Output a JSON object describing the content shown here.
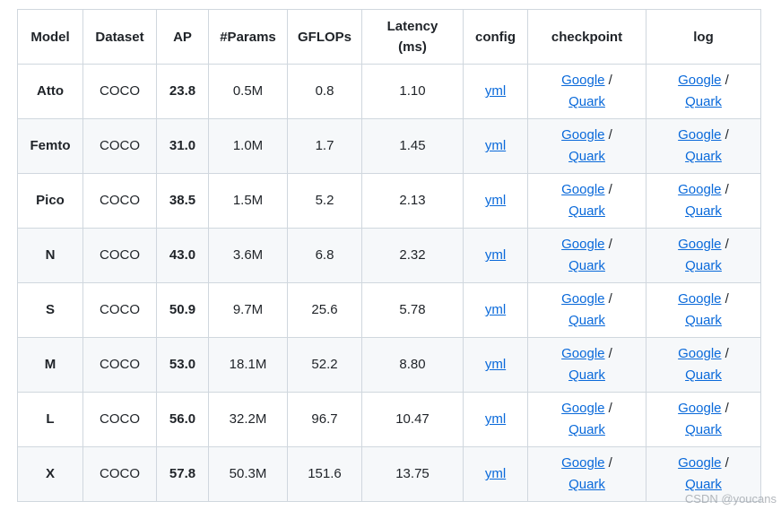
{
  "headers": [
    "Model",
    "Dataset",
    "AP",
    "#Params",
    "GFLOPs",
    "Latency",
    "config",
    "checkpoint",
    "log"
  ],
  "latency_unit": "(ms)",
  "rows": [
    {
      "model": "Atto",
      "dataset": "COCO",
      "ap": "23.8",
      "params": "0.5M",
      "gflops": "0.8",
      "latency": "1.10"
    },
    {
      "model": "Femto",
      "dataset": "COCO",
      "ap": "31.0",
      "params": "1.0M",
      "gflops": "1.7",
      "latency": "1.45"
    },
    {
      "model": "Pico",
      "dataset": "COCO",
      "ap": "38.5",
      "params": "1.5M",
      "gflops": "5.2",
      "latency": "2.13"
    },
    {
      "model": "N",
      "dataset": "COCO",
      "ap": "43.0",
      "params": "3.6M",
      "gflops": "6.8",
      "latency": "2.32"
    },
    {
      "model": "S",
      "dataset": "COCO",
      "ap": "50.9",
      "params": "9.7M",
      "gflops": "25.6",
      "latency": "5.78"
    },
    {
      "model": "M",
      "dataset": "COCO",
      "ap": "53.0",
      "params": "18.1M",
      "gflops": "52.2",
      "latency": "8.80"
    },
    {
      "model": "L",
      "dataset": "COCO",
      "ap": "56.0",
      "params": "32.2M",
      "gflops": "96.7",
      "latency": "10.47"
    },
    {
      "model": "X",
      "dataset": "COCO",
      "ap": "57.8",
      "params": "50.3M",
      "gflops": "151.6",
      "latency": "13.75"
    }
  ],
  "links": {
    "config": "yml",
    "google": "Google",
    "quark": "Quark",
    "separator": " /"
  },
  "watermark": "CSDN @youcans",
  "colors": {
    "link": "#0969da",
    "border": "#d0d7de",
    "stripe": "#f6f8fa"
  }
}
